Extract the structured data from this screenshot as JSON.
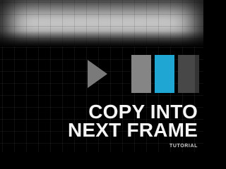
{
  "title": {
    "line1": "COPY INTO",
    "line2": "NEXT FRAME"
  },
  "tag": "TUTORIAL",
  "icons": {
    "play": "play-icon"
  },
  "colors": {
    "frame_1": "#858585",
    "frame_2": "#1fa6d2",
    "frame_3": "#474747",
    "text": "#f5f5f5",
    "background": "#000000"
  }
}
